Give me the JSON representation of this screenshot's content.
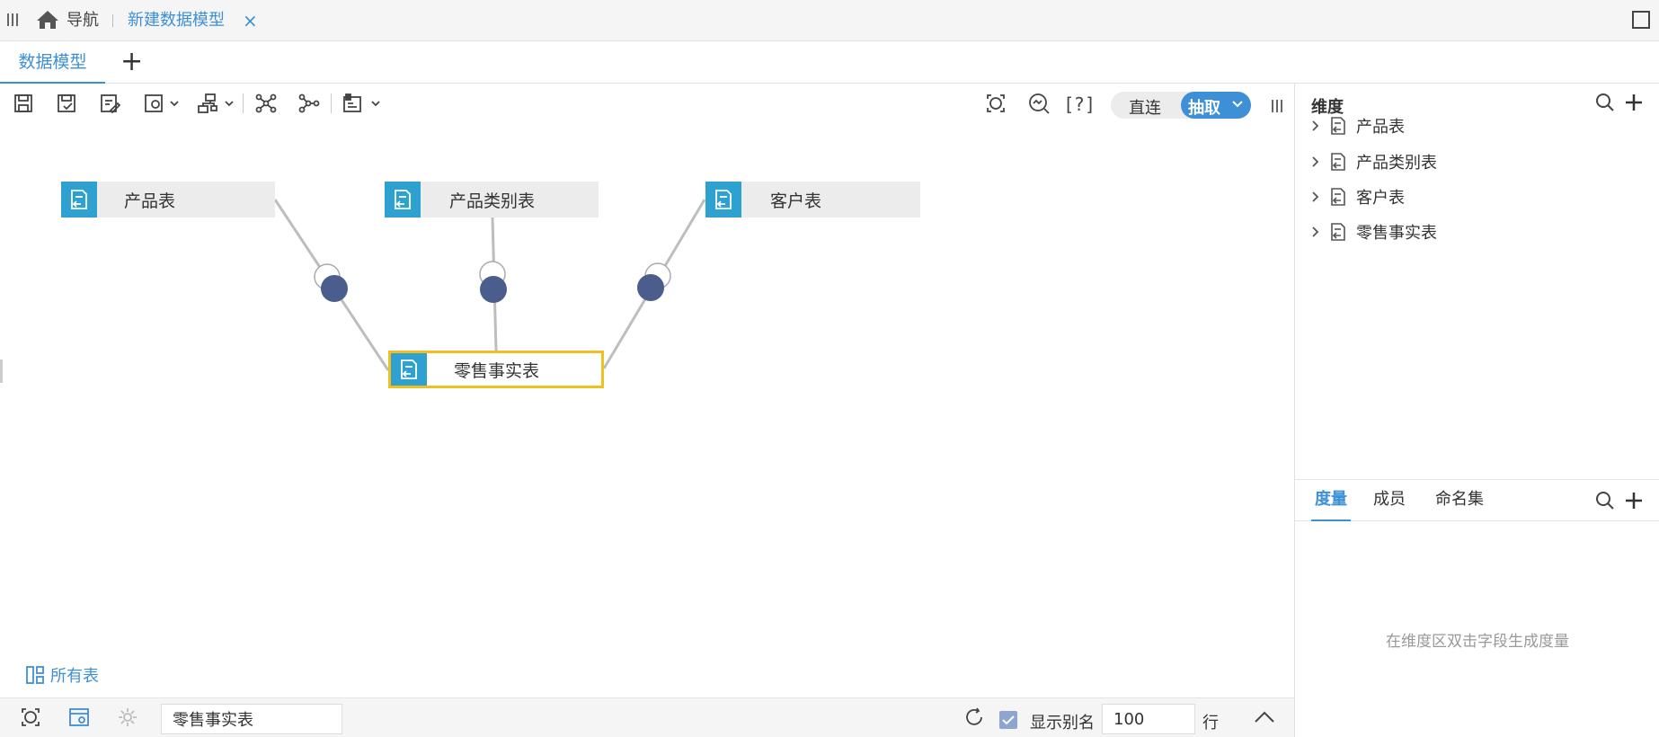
{
  "topbar": {
    "nav_label": "导航",
    "active_tab_label": "新建数据模型",
    "close_glyph": "×"
  },
  "tabs": {
    "model_tab_label": "数据模型",
    "add_glyph": "+"
  },
  "toolbar": {
    "mode_direct_label": "直连",
    "mode_extract_label": "抽取",
    "help_label": "[?]"
  },
  "canvas": {
    "nodes": {
      "product": "产品表",
      "category": "产品类别表",
      "customer": "客户表",
      "fact": "零售事实表"
    },
    "all_tables_label": "所有表"
  },
  "right_panel": {
    "dimension_title": "维度",
    "dimension_items": [
      "产品表",
      "产品类别表",
      "客户表",
      "零售事实表"
    ],
    "measure_tabs": [
      "度量",
      "成员",
      "命名集"
    ],
    "measure_empty_hint": "在维度区双击字段生成度量"
  },
  "bottombar": {
    "table_name_value": "零售事实表",
    "show_alias_label": "显示别名",
    "row_count_value": "100",
    "row_unit_label": "行"
  },
  "colors": {
    "accent": "#3d8fd6",
    "node_icon": "#2ea1d0",
    "selected_border": "#f0c020",
    "relation_dot": "#4a5d8c",
    "mode_active": "#3d8fd6"
  }
}
